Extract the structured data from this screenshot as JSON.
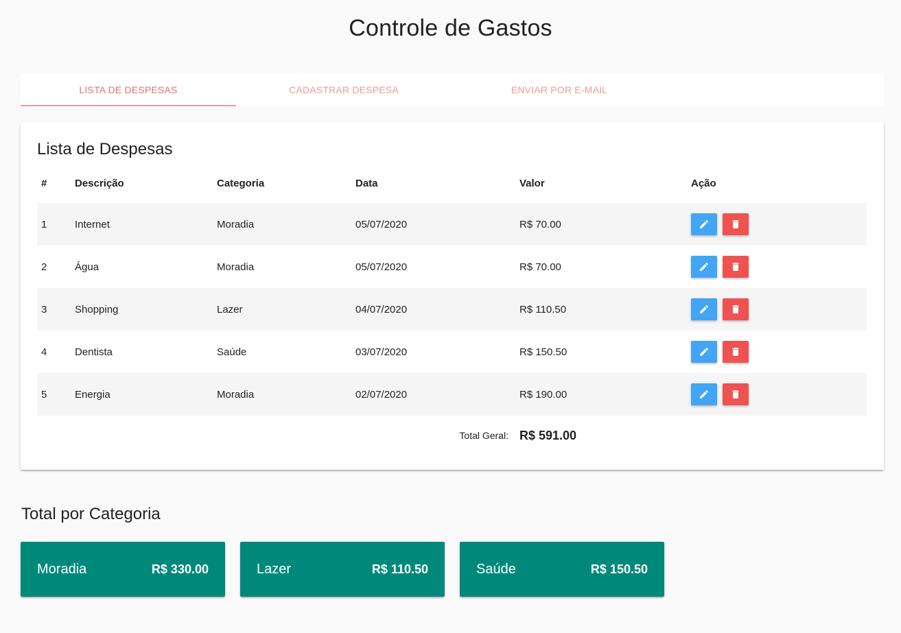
{
  "app": {
    "title": "Controle de Gastos"
  },
  "tabs": [
    {
      "label": "LISTA DE DESPESAS",
      "active": true
    },
    {
      "label": "CADASTRAR DESPESA",
      "active": false
    },
    {
      "label": "ENVIAR POR E-MAIL",
      "active": false
    }
  ],
  "list": {
    "title": "Lista de Despesas",
    "columns": [
      "#",
      "Descrição",
      "Categoria",
      "Data",
      "Valor",
      "Ação"
    ],
    "rows": [
      {
        "num": "1",
        "desc": "Internet",
        "cat": "Moradia",
        "date": "05/07/2020",
        "value": "R$ 70.00"
      },
      {
        "num": "2",
        "desc": "Água",
        "cat": "Moradia",
        "date": "05/07/2020",
        "value": "R$ 70.00"
      },
      {
        "num": "3",
        "desc": "Shopping",
        "cat": "Lazer",
        "date": "04/07/2020",
        "value": "R$ 110.50"
      },
      {
        "num": "4",
        "desc": "Dentista",
        "cat": "Saúde",
        "date": "03/07/2020",
        "value": "R$ 150.50"
      },
      {
        "num": "5",
        "desc": "Energia",
        "cat": "Moradia",
        "date": "02/07/2020",
        "value": "R$ 190.00"
      }
    ],
    "total_label": "Total Geral:",
    "total_value": "R$ 591.00"
  },
  "categories": {
    "title": "Total por Categoria",
    "items": [
      {
        "name": "Moradia",
        "value": "R$ 330.00"
      },
      {
        "name": "Lazer",
        "value": "R$ 110.50"
      },
      {
        "name": "Saúde",
        "value": "R$ 150.50"
      }
    ]
  },
  "colors": {
    "tab_active": "#e57373",
    "tab_inactive": "#ef9a9a",
    "edit_button": "#42a5f5",
    "delete_button": "#ef5350",
    "category_card": "#00897b"
  },
  "icons": {
    "edit": "pencil-icon",
    "delete": "trash-icon"
  }
}
